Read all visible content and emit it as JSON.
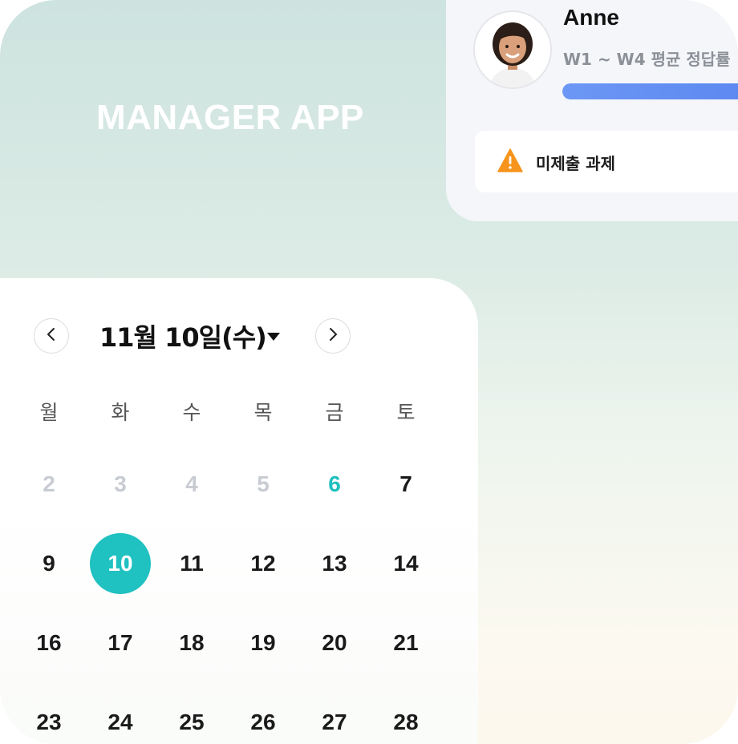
{
  "app": {
    "title": "MANAGER APP"
  },
  "student": {
    "name": "Anne",
    "average_label": "W1 ~ W4 평균 정답률",
    "average_progress_percent": 100
  },
  "alerts": [
    {
      "label": "미제출 과제",
      "icon": "warning-icon"
    }
  ],
  "calendar": {
    "title": "11월 10일(수)",
    "weekdays": [
      "월",
      "화",
      "수",
      "목",
      "금",
      "토"
    ],
    "rows": [
      [
        {
          "d": "2",
          "s": "muted"
        },
        {
          "d": "3",
          "s": "muted"
        },
        {
          "d": "4",
          "s": "muted"
        },
        {
          "d": "5",
          "s": "muted"
        },
        {
          "d": "6",
          "s": "accent"
        },
        {
          "d": "7",
          "s": ""
        }
      ],
      [
        {
          "d": "9",
          "s": ""
        },
        {
          "d": "10",
          "s": "selected"
        },
        {
          "d": "11",
          "s": ""
        },
        {
          "d": "12",
          "s": ""
        },
        {
          "d": "13",
          "s": ""
        },
        {
          "d": "14",
          "s": ""
        }
      ],
      [
        {
          "d": "16",
          "s": ""
        },
        {
          "d": "17",
          "s": ""
        },
        {
          "d": "18",
          "s": ""
        },
        {
          "d": "19",
          "s": ""
        },
        {
          "d": "20",
          "s": ""
        },
        {
          "d": "21",
          "s": ""
        }
      ],
      [
        {
          "d": "23",
          "s": ""
        },
        {
          "d": "24",
          "s": ""
        },
        {
          "d": "25",
          "s": ""
        },
        {
          "d": "26",
          "s": ""
        },
        {
          "d": "27",
          "s": ""
        },
        {
          "d": "28",
          "s": ""
        }
      ]
    ]
  },
  "colors": {
    "accent": "#1fc1c1",
    "progress": "#6c97f5",
    "warning": "#f7941d"
  }
}
